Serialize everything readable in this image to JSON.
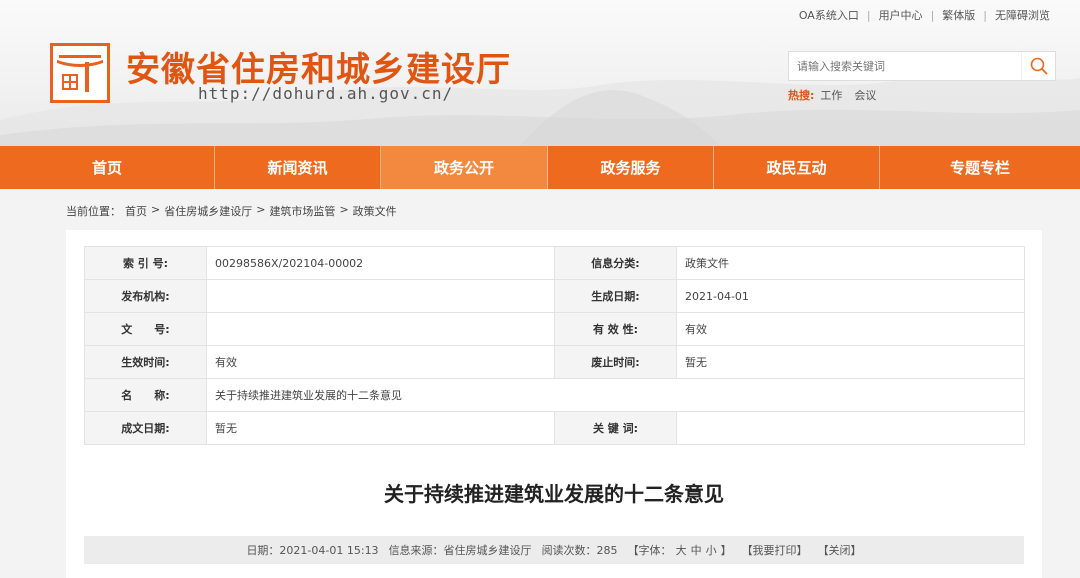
{
  "toplinks": [
    "OA系统入口",
    "用户中心",
    "繁体版",
    "无障碍浏览"
  ],
  "header": {
    "title": "安徽省住房和城乡建设厅",
    "url": "http://dohurd.ah.gov.cn/"
  },
  "search": {
    "placeholder": "请输入搜索关键词"
  },
  "hot": {
    "label": "热搜:",
    "words": [
      "工作",
      "会议"
    ]
  },
  "nav": [
    {
      "label": "首页"
    },
    {
      "label": "新闻资讯"
    },
    {
      "label": "政务公开",
      "active": true
    },
    {
      "label": "政务服务"
    },
    {
      "label": "政民互动"
    },
    {
      "label": "专题专栏"
    }
  ],
  "breadcrumb": {
    "prefix": "当前位置：",
    "items": [
      "首页",
      "省住房城乡建设厅",
      "建筑市场监管",
      "政策文件"
    ]
  },
  "meta": {
    "index_label": "索 引 号:",
    "index_value": "00298586X/202104-00002",
    "category_label": "信息分类:",
    "category_value": "政策文件",
    "publisher_label": "发布机构:",
    "publisher_value": "",
    "gen_date_label": "生成日期:",
    "gen_date_value": "2021-04-01",
    "docno_label": "文　　号:",
    "docno_value": "",
    "validity_label": "有 效 性:",
    "validity_value": "有效",
    "effective_label": "生效时间:",
    "effective_value": "有效",
    "repeal_label": "废止时间:",
    "repeal_value": "暂无",
    "name_label": "名　　称:",
    "name_value": "关于持续推进建筑业发展的十二条意见",
    "date_label": "成文日期:",
    "date_value": "暂无",
    "keywords_label": "关 键 词:",
    "keywords_value": ""
  },
  "article": {
    "title": "关于持续推进建筑业发展的十二条意见",
    "date": "日期：2021-04-01 15:13",
    "source": "信息来源：省住房城乡建设厅",
    "views": "阅读次数：285",
    "font_prefix": "【字体：",
    "font_large": "大",
    "font_medium": "中",
    "font_small": "小",
    "font_suffix": "】",
    "print": "【我要打印】",
    "close": "【关闭】"
  },
  "colors": {
    "brand": "#ed6a1e",
    "title": "#e15512",
    "nav_active": "#f3893f"
  },
  "icons": {
    "search": "search-icon",
    "logo": "emblem-logo"
  }
}
